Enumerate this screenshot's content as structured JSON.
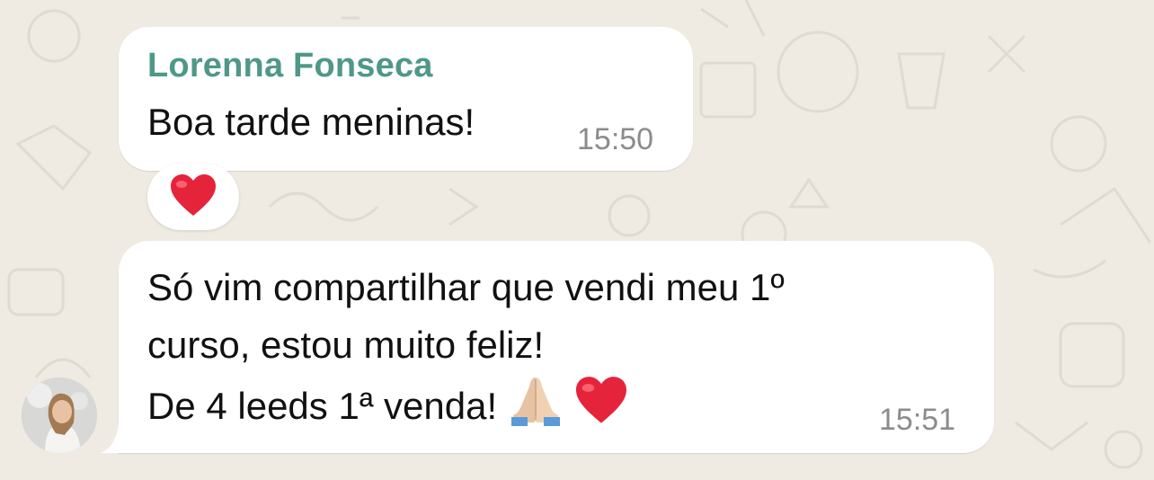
{
  "chat": {
    "messages": [
      {
        "sender": "Lorenna Fonseca",
        "text": "Boa tarde meninas!",
        "time": "15:50",
        "reaction": "heart-icon"
      },
      {
        "lines": [
          "Só vim compartilhar que vendi meu 1º",
          "curso, estou muito feliz!",
          "De 4 leeds 1ª venda!"
        ],
        "trailing_emojis": [
          "folded-hands-icon",
          "heart-icon"
        ],
        "time": "15:51"
      }
    ]
  },
  "colors": {
    "background": "#efeae2",
    "bubble": "#ffffff",
    "sender_name": "#4f9888",
    "timestamp": "#8c8c8c",
    "heart": "#e5243b"
  }
}
